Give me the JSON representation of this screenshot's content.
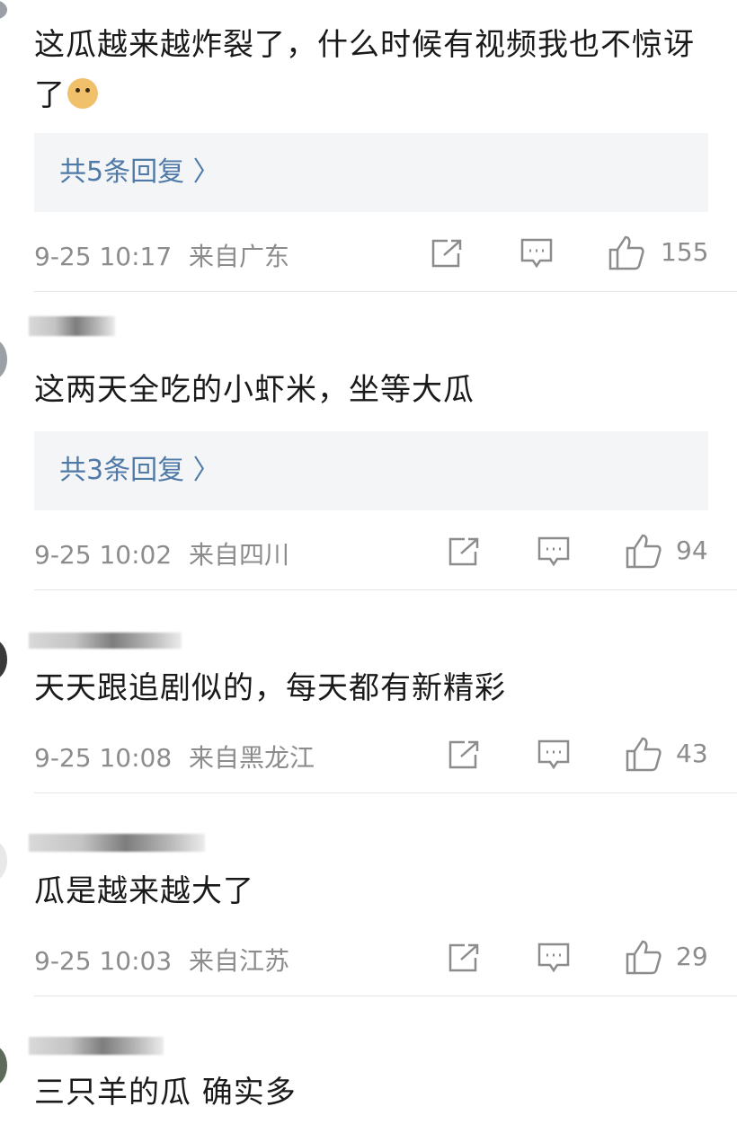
{
  "comments": [
    {
      "text": "这瓜越来越炸裂了，什么时候有视频我也不惊讶了",
      "emoji": "doge-emoji",
      "replies": "共5条回复 〉",
      "time": "9-25 10:17",
      "location": "来自广东",
      "likes": "155"
    },
    {
      "text": "这两天全吃的小虾米，坐等大瓜",
      "replies": "共3条回复 〉",
      "time": "9-25 10:02",
      "location": "来自四川",
      "likes": "94"
    },
    {
      "text": "天天跟追剧似的，每天都有新精彩",
      "time": "9-25 10:08",
      "location": "来自黑龙江",
      "likes": "43"
    },
    {
      "text": "瓜是越来越大了",
      "time": "9-25 10:03",
      "location": "来自江苏",
      "likes": "29"
    },
    {
      "text": "三只羊的瓜 确实多"
    }
  ],
  "icons": {
    "share": "share-icon",
    "comment": "comment-icon",
    "like": "thumbs-up-icon"
  },
  "colors": {
    "reply_link": "#4f7aa8",
    "meta_text": "#8c8c8c",
    "reply_bg": "#f4f5f7"
  }
}
